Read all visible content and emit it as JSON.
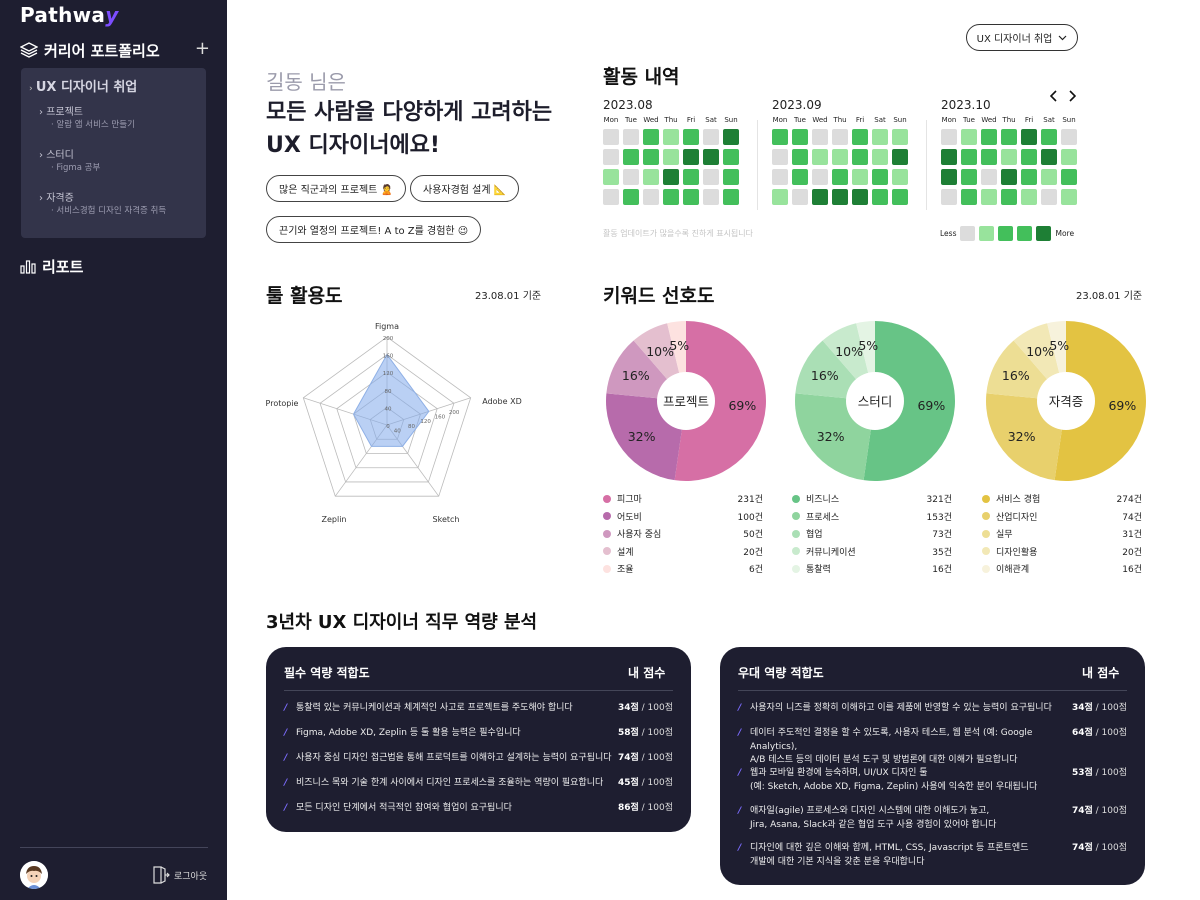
{
  "brand": {
    "name": "Pathwa",
    "suffix": "y",
    "accent": "#7c4dff"
  },
  "sidebar": {
    "portfolio_label": "커리어 포트폴리오",
    "add_label": "+",
    "folder": {
      "title": "UX 디자이너 취업",
      "sections": [
        {
          "label": "프로젝트",
          "items": [
            "알람 앱 서비스 만들기"
          ]
        },
        {
          "label": "스터디",
          "items": [
            "Figma 공부"
          ]
        },
        {
          "label": "자격증",
          "items": [
            "서비스경험 디자인 자격증 취득"
          ]
        }
      ]
    },
    "report_label": "리포트",
    "logout_label": "로그아웃"
  },
  "header": {
    "selector_value": "UX 디자이너 취업"
  },
  "profile": {
    "greeting": "길동 님은",
    "line1": "모든 사람을 다양하게 고려하는",
    "line2": "UX 디자이너에요!",
    "tags": [
      "많은 직군과의 프로젝트 🙎",
      "사용자경험 설계 📐",
      "끈기와 열정의 프로젝트! A to Z를 경험한 😉"
    ]
  },
  "activity": {
    "title": "활동 내역",
    "weekdays": [
      "Mon",
      "Tue",
      "Wed",
      "Thu",
      "Fri",
      "Sat",
      "Sun"
    ],
    "months": [
      {
        "label": "2023.08",
        "cells": [
          0,
          0,
          2,
          1,
          2,
          0,
          3,
          0,
          2,
          2,
          1,
          3,
          3,
          2,
          1,
          0,
          1,
          3,
          2,
          0,
          2,
          0,
          2,
          0,
          2,
          2,
          0,
          2
        ]
      },
      {
        "label": "2023.09",
        "cells": [
          2,
          2,
          0,
          0,
          2,
          1,
          1,
          0,
          2,
          1,
          1,
          2,
          1,
          3,
          0,
          2,
          0,
          2,
          1,
          2,
          1,
          1,
          0,
          3,
          3,
          3,
          2,
          2
        ]
      },
      {
        "label": "2023.10",
        "cells": [
          0,
          1,
          2,
          2,
          3,
          2,
          0,
          3,
          2,
          2,
          1,
          2,
          3,
          1,
          3,
          2,
          0,
          3,
          2,
          1,
          2,
          0,
          2,
          1,
          2,
          1,
          0,
          1
        ]
      }
    ],
    "hint": "활동 업데이트가 많을수록 진하게 표시됩니다",
    "legend_less": "Less",
    "legend_more": "More",
    "colors": [
      "#dcdcdc",
      "#98e39c",
      "#43bf5b",
      "#1e7f35"
    ]
  },
  "tools": {
    "title": "툴 활용도",
    "basis": "23.08.01 기준",
    "chart_data": {
      "type": "radar",
      "axes": [
        "Figma",
        "Adobe XD",
        "Sketch",
        "Zeplin",
        "Protopie"
      ],
      "values": [
        160,
        100,
        60,
        60,
        80
      ],
      "ticks": [
        "0",
        "40",
        "80",
        "120",
        "160",
        "200"
      ],
      "rlim": [
        0,
        200
      ]
    }
  },
  "keywords": {
    "title": "키워드 선호도",
    "basis": "23.08.01 기준",
    "chart_data": [
      {
        "type": "pie",
        "title": "프로젝트",
        "slice_labels": [
          "69%",
          "32%",
          "16%",
          "10%",
          "5%"
        ],
        "slice_values": [
          69,
          32,
          16,
          10,
          5
        ],
        "colors": [
          "#d66fa5",
          "#b76bab",
          "#cf98bf",
          "#e4bfcf",
          "#fde2e0"
        ],
        "legend": [
          {
            "name": "피그마",
            "count": "231건"
          },
          {
            "name": "어도비",
            "count": "100건"
          },
          {
            "name": "사용자 중심",
            "count": "50건"
          },
          {
            "name": "설계",
            "count": "20건"
          },
          {
            "name": "조율",
            "count": "6건"
          }
        ]
      },
      {
        "type": "pie",
        "title": "스터디",
        "slice_labels": [
          "69%",
          "32%",
          "16%",
          "10%",
          "5%"
        ],
        "slice_values": [
          69,
          32,
          16,
          10,
          5
        ],
        "colors": [
          "#67c486",
          "#8fd49e",
          "#aadfb5",
          "#c8eacd",
          "#e4f4e4"
        ],
        "legend": [
          {
            "name": "비즈니스",
            "count": "321건"
          },
          {
            "name": "프로세스",
            "count": "153건"
          },
          {
            "name": "협업",
            "count": "73건"
          },
          {
            "name": "커뮤니케이션",
            "count": "35건"
          },
          {
            "name": "통찰력",
            "count": "16건"
          }
        ]
      },
      {
        "type": "pie",
        "title": "자격증",
        "slice_labels": [
          "69%",
          "32%",
          "16%",
          "10%",
          "5%"
        ],
        "slice_values": [
          69,
          32,
          16,
          10,
          5
        ],
        "colors": [
          "#e3c342",
          "#e8d06c",
          "#edde94",
          "#f2e8b6",
          "#f7f2dc"
        ],
        "legend": [
          {
            "name": "서비스 경험",
            "count": "274건"
          },
          {
            "name": "산업디자인",
            "count": "74건"
          },
          {
            "name": "실무",
            "count": "31건"
          },
          {
            "name": "디자인활용",
            "count": "20건"
          },
          {
            "name": "이해관계",
            "count": "16건"
          }
        ]
      }
    ]
  },
  "competence": {
    "title": "3년차 UX 디자이너 직무 역량 분석",
    "required": {
      "header": "필수 역량 적합도",
      "score_header": "내 점수",
      "rows": [
        {
          "text": "통찰력 있는 커뮤니케이션과 체계적인 사고로 프로젝트를 주도해야 합니다",
          "score": "34점",
          "total": " / 100점"
        },
        {
          "text": "Figma, Adobe XD, Zeplin 등 툴 활용 능력은 필수입니다",
          "score": "58점",
          "total": " / 100점"
        },
        {
          "text": "사용자 중심 디자인 접근법을 통해 프로덕트를 이해하고 설계하는 능력이 요구됩니다",
          "score": "74점",
          "total": " / 100점"
        },
        {
          "text": "비즈니스 목와 기술 한계 사이에서 디자인 프로세스를 조율하는 역량이 필요합니다",
          "score": "45점",
          "total": " / 100점"
        },
        {
          "text": "모든 디자인 단계에서 적극적인 참여와 협업이 요구됩니다",
          "score": "86점",
          "total": " / 100점"
        }
      ]
    },
    "preferred": {
      "header": "우대 역량 적합도",
      "score_header": "내 점수",
      "rows": [
        {
          "text": "사용자의 니즈를 정확히 이해하고 이를 제품에 반영할 수 있는 능력이 요구됩니다",
          "text2": "",
          "score": "34점",
          "total": " / 100점"
        },
        {
          "text": "데이터 주도적인 결정을 할 수 있도록, 사용자 테스트, 웹 분석 (예: Google Analytics),",
          "text2": "A/B 테스트 등의 데이터 분석 도구 및 방법론에 대한 이해가 필요합니다",
          "score": "64점",
          "total": " / 100점"
        },
        {
          "text": "웹과 모바일 환경에 능숙하며, UI/UX 디자인 툴",
          "text2": "(예: Sketch, Adobe XD, Figma, Zeplin) 사용에 익숙한 분이 우대됩니다",
          "score": "53점",
          "total": " / 100점"
        },
        {
          "text": "애자일(agile) 프로세스와 디자인 시스템에 대한 이해도가 높고,",
          "text2": "Jira, Asana, Slack과 같은 협업 도구 사용 경험이 있어야 합니다",
          "score": "74점",
          "total": " / 100점"
        },
        {
          "text": "디자인에 대한 깊은 이해와 함께, HTML, CSS, Javascript 등 프론트엔드",
          "text2": "개발에 대한 기본 지식을 갖춘 분을 우대합니다",
          "score": "74점",
          "total": " / 100점"
        }
      ]
    }
  }
}
